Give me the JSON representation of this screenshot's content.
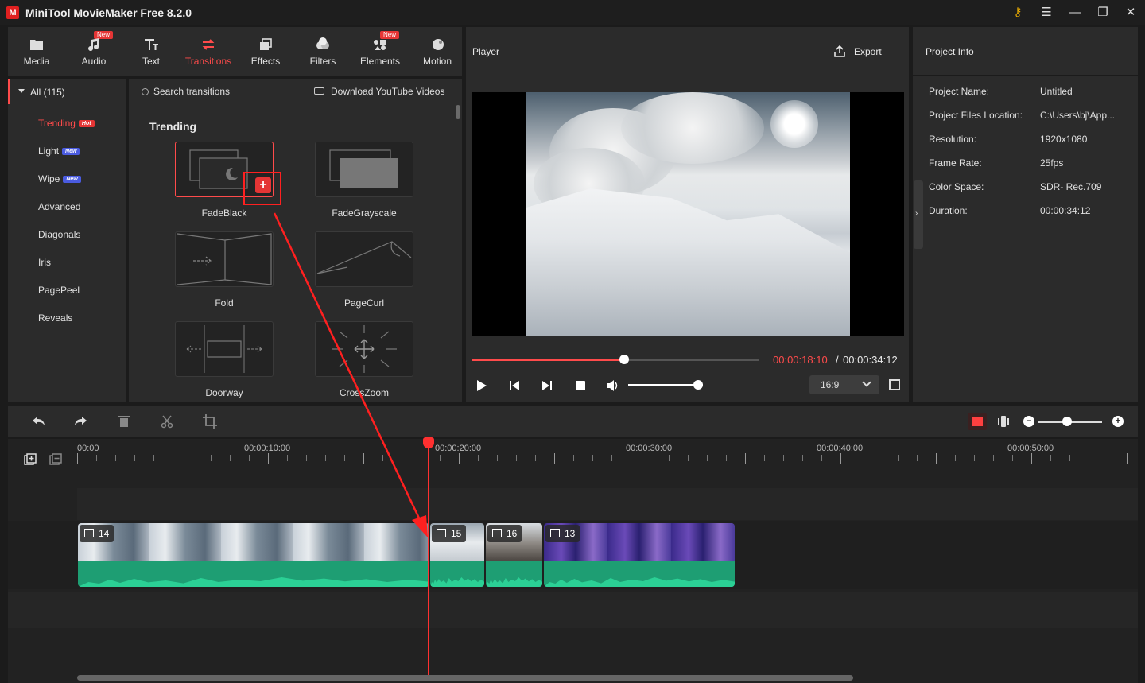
{
  "app": {
    "title": "MiniTool MovieMaker Free 8.2.0",
    "logo_letter": "M"
  },
  "toolbar": {
    "tabs": [
      {
        "label": "Media",
        "icon": "folder-icon"
      },
      {
        "label": "Audio",
        "icon": "music-note-icon",
        "badge": "New"
      },
      {
        "label": "Text",
        "icon": "text-icon"
      },
      {
        "label": "Transitions",
        "icon": "transitions-icon",
        "active": true
      },
      {
        "label": "Effects",
        "icon": "effects-icon"
      },
      {
        "label": "Filters",
        "icon": "filters-icon"
      },
      {
        "label": "Elements",
        "icon": "elements-icon",
        "badge": "New"
      },
      {
        "label": "Motion",
        "icon": "motion-icon"
      }
    ]
  },
  "sidebar": {
    "all_label": "All (115)",
    "items": [
      {
        "label": "Trending",
        "tag": "Hot",
        "active": true
      },
      {
        "label": "Light",
        "tag": "New"
      },
      {
        "label": "Wipe",
        "tag": "New"
      },
      {
        "label": "Advanced"
      },
      {
        "label": "Diagonals"
      },
      {
        "label": "Iris"
      },
      {
        "label": "PagePeel"
      },
      {
        "label": "Reveals"
      }
    ]
  },
  "browser": {
    "search_placeholder": "Search transitions",
    "youtube_label": "Download YouTube Videos",
    "section_title": "Trending",
    "items": [
      {
        "label": "FadeBlack",
        "selected": true
      },
      {
        "label": "FadeGrayscale"
      },
      {
        "label": "Fold"
      },
      {
        "label": "PageCurl"
      },
      {
        "label": "Doorway"
      },
      {
        "label": "CrossZoom"
      }
    ],
    "add_symbol": "+"
  },
  "player": {
    "title": "Player",
    "export_label": "Export",
    "current_time": "00:00:18:10",
    "separator": "/",
    "total_time": "00:00:34:12",
    "progress": 0.53,
    "volume": 0.94,
    "aspect_ratio": "16:9"
  },
  "project_info": {
    "title": "Project Info",
    "rows": [
      {
        "key": "Project Name:",
        "value": "Untitled"
      },
      {
        "key": "Project Files Location:",
        "value": "C:\\Users\\bj\\App..."
      },
      {
        "key": "Resolution:",
        "value": "1920x1080"
      },
      {
        "key": "Frame Rate:",
        "value": "25fps"
      },
      {
        "key": "Color Space:",
        "value": "SDR- Rec.709"
      },
      {
        "key": "Duration:",
        "value": "00:00:34:12"
      }
    ]
  },
  "timeline": {
    "ruler_labels": [
      "00:00",
      "00:00:10:00",
      "00:00:20:00",
      "00:00:30:00",
      "00:00:40:00",
      "00:00:50:00"
    ],
    "clips": [
      {
        "number": "14",
        "theme": "mountain-clouds"
      },
      {
        "number": "15",
        "theme": "snow"
      },
      {
        "number": "16",
        "theme": "snow-rocks"
      },
      {
        "number": "13",
        "theme": "purple-reef"
      }
    ],
    "zoom_minus": "−",
    "zoom_plus": "+"
  },
  "colors": {
    "accent": "#ff4b4b",
    "panel": "#2b2b2b",
    "background": "#1b1b1b",
    "audio_wave": "#2bd095"
  }
}
